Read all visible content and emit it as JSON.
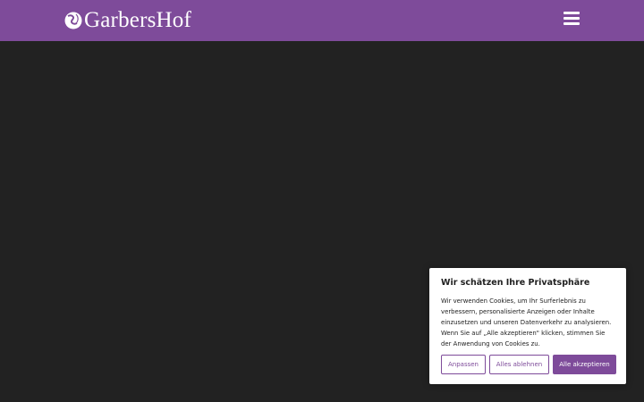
{
  "header": {
    "logo_text": "GarbersHof",
    "background_color": "#7e4b9a"
  },
  "icons": {
    "logo_mark": "globe-swirl-icon",
    "menu": "hamburger-menu-icon"
  },
  "cookie_banner": {
    "title": "Wir schätzen Ihre Privatsphäre",
    "text": "Wir verwenden Cookies, um Ihr Surferlebnis zu verbessern, personalisierte Anzeigen oder Inhalte einzusetzen und unseren Datenverkehr zu analysieren. Wenn Sie auf „Alle akzeptieren\" klicken, stimmen Sie der Anwendung von Cookies zu.",
    "buttons": {
      "customize": "Anpassen",
      "reject": "Alles ablehnen",
      "accept": "Alle akzeptieren"
    },
    "accent_color": "#7e4b9a"
  },
  "page": {
    "background_color": "#222222"
  }
}
